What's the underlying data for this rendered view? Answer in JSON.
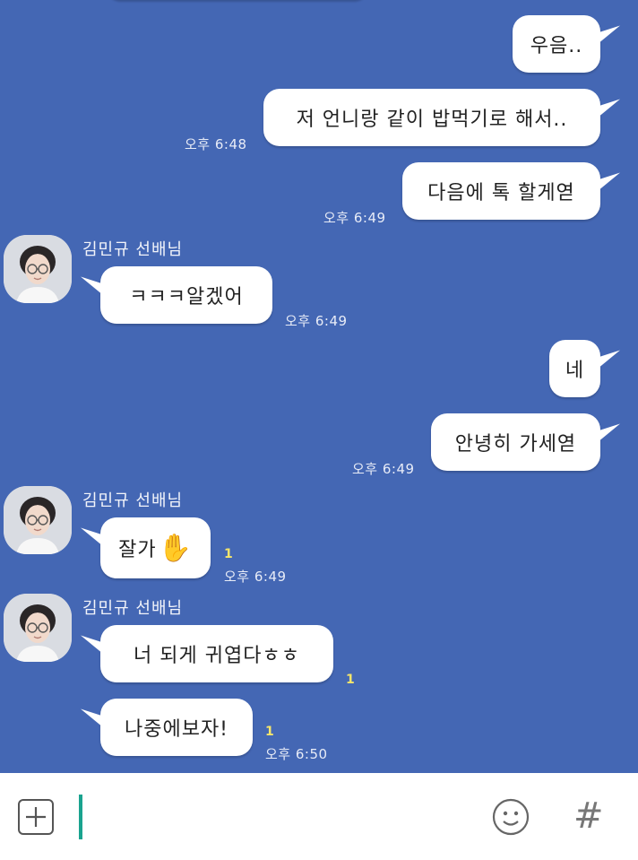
{
  "messages": {
    "m1": {
      "text": "우음..",
      "time": ""
    },
    "m2": {
      "text": "저 언니랑 같이 밥먹기로 해서..",
      "time": "오후 6:48"
    },
    "m3": {
      "text": "다음에 톡 할게엳",
      "time": "오후 6:49"
    },
    "m4": {
      "sender": "김민규 선배님",
      "text": "ㅋㅋㅋ알겠어",
      "time": "오후 6:49"
    },
    "m5": {
      "text": "네",
      "time": ""
    },
    "m6": {
      "text": "안녕히 가세엳",
      "time": "오후 6:49"
    },
    "m7": {
      "sender": "김민규 선배님",
      "text": "잘가",
      "emoji": "✋",
      "unread": "1",
      "time": "오후 6:49"
    },
    "m8": {
      "sender": "김민규 선배님",
      "text": "너 되게 귀엽다ㅎㅎ",
      "unread": "1"
    },
    "m9": {
      "text": "나중에보자!",
      "unread": "1",
      "time": "오후 6:50"
    }
  },
  "input_bar": {
    "plus_icon": "plus-box-icon",
    "emoji_icon": "smiley-icon",
    "hash_label": "#",
    "input_value": ""
  },
  "colors": {
    "chat_background": "#4467b4",
    "bubble": "#ffffff",
    "unread_count": "#f5e56b",
    "caret": "#1aa38f"
  }
}
